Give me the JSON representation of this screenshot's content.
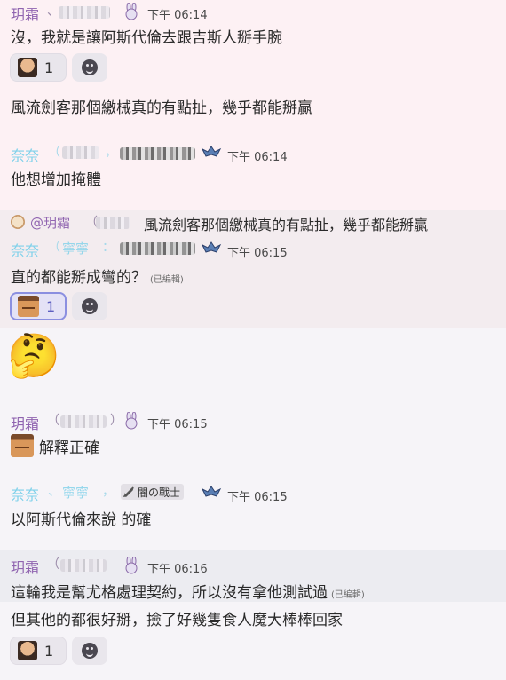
{
  "messages": [
    {
      "author": "玥霜",
      "time": "下午 06:14",
      "text": "沒，我就是讓阿斯代倫去跟吉斯人掰手腕",
      "reaction_count": "1"
    },
    {
      "text": "風流劍客那個繳械真的有點扯，幾乎都能掰贏"
    },
    {
      "author": "奈奈",
      "time": "下午 06:14",
      "text": "他想增加掩體"
    },
    {
      "reply_to": "@玥霜",
      "reply_text": "風流劍客那個繳械真的有點扯，幾乎都能掰贏",
      "author": "奈奈",
      "author_partial": "寧寧",
      "time": "下午 06:15",
      "text": "直的都能掰成彎的？",
      "edited": "(已編輯)",
      "reaction_count": "1"
    },
    {
      "emoji": "🤔"
    },
    {
      "author": "玥霜",
      "time": "下午 06:15",
      "text": "解釋正確"
    },
    {
      "author": "奈奈",
      "author_partial": "寧寧",
      "tag": "闇の戰士",
      "time": "下午 06:15",
      "text": "以阿斯代倫來說 的確"
    },
    {
      "author": "玥霜",
      "time": "下午 06:16",
      "text": "這輪我是幫尤格處理契約，所以沒有拿他測試過",
      "edited": "(已編輯)"
    },
    {
      "text": "但其他的都很好掰，撿了好幾隻食人魔大棒棒回家",
      "reaction_count": "1"
    }
  ]
}
